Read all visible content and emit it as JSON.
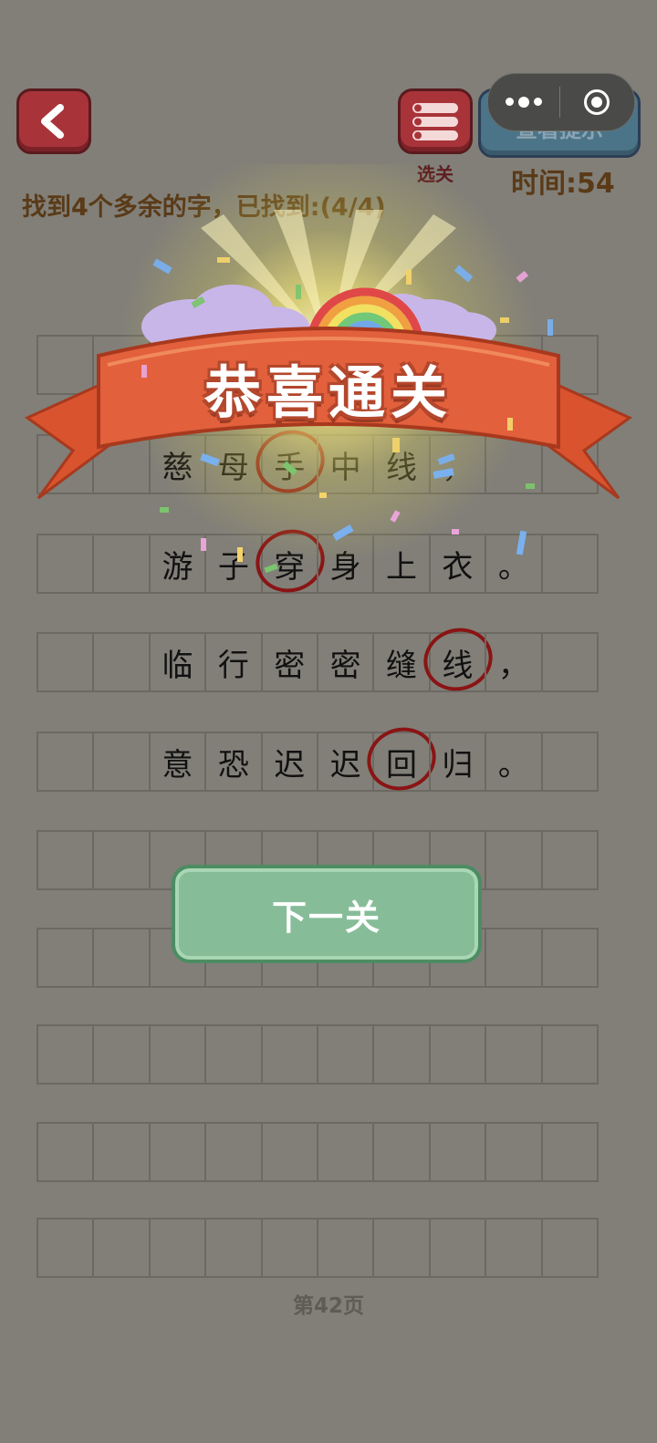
{
  "header": {
    "levels_label": "选关",
    "hint_label": "查看提示",
    "timer": "时间:54",
    "instruction": "找到4个多余的字，已找到:(4/4)"
  },
  "grid": {
    "rows": [
      [
        "",
        "",
        "",
        "",
        "",
        "",
        "",
        "",
        "",
        ""
      ],
      [
        "",
        "",
        "慈",
        "母",
        "手",
        "中",
        "线",
        "，",
        "",
        ""
      ],
      [
        "",
        "",
        "游",
        "子",
        "穿",
        "身",
        "上",
        "衣",
        "。",
        ""
      ],
      [
        "",
        "",
        "临",
        "行",
        "密",
        "密",
        "缝",
        "线",
        "，",
        ""
      ],
      [
        "",
        "",
        "意",
        "恐",
        "迟",
        "迟",
        "回",
        "归",
        "。",
        ""
      ],
      [
        "",
        "",
        "",
        "",
        "",
        "",
        "",
        "",
        "",
        ""
      ],
      [
        "",
        "",
        "",
        "",
        "",
        "",
        "",
        "",
        "",
        ""
      ],
      [
        "",
        "",
        "",
        "",
        "",
        "",
        "",
        "",
        "",
        ""
      ],
      [
        "",
        "",
        "",
        "",
        "",
        "",
        "",
        "",
        "",
        ""
      ],
      [
        "",
        "",
        "",
        "",
        "",
        "",
        "",
        "",
        "",
        ""
      ]
    ]
  },
  "overlay": {
    "title": "恭喜通关",
    "next_button": "下一关"
  },
  "footer": {
    "page_label": "第42页"
  },
  "colors": {
    "background": "#817f78",
    "button_red": "#a8343a",
    "button_blue": "#4c7488",
    "button_green": "#86bd98",
    "ribbon": "#e2603c",
    "circle_mark": "#8a1414"
  }
}
